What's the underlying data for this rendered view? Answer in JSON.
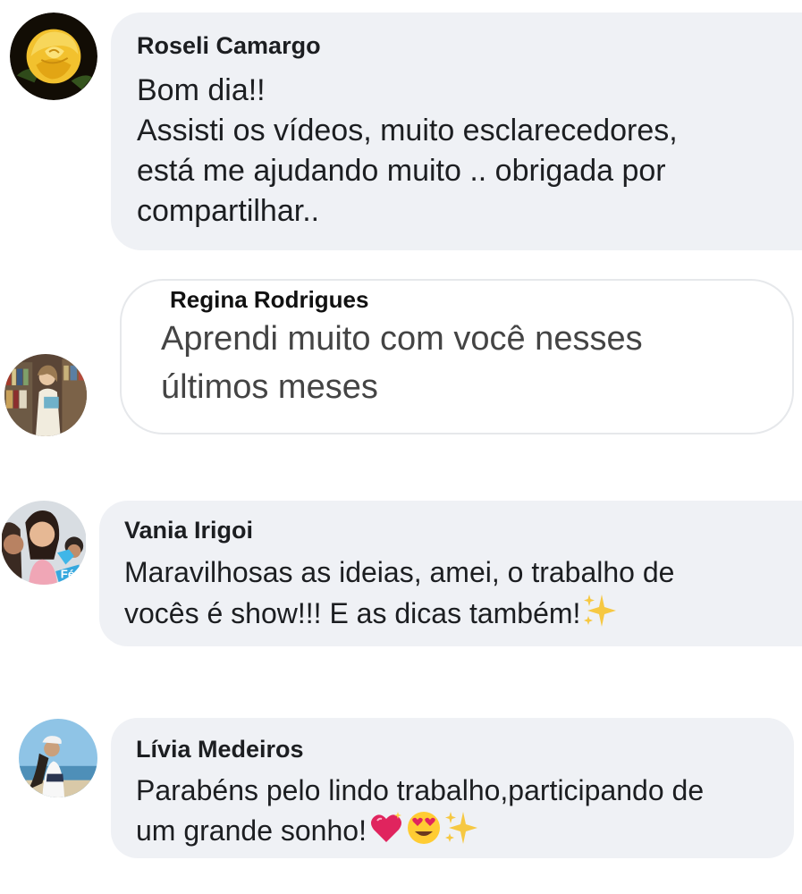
{
  "comments": [
    {
      "author": "Roseli Camargo",
      "lines": [
        "Bom dia!!",
        "Assisti os vídeos, muito esclarecedores,",
        "está me ajudando muito .. obrigada por",
        "compartilhar.."
      ],
      "avatar_icon": "yellow-rose-avatar"
    },
    {
      "author": "Regina Rodrigues",
      "lines": [
        "Aprendi muito com você nesses",
        "últimos meses"
      ],
      "avatar_icon": "woman-library-avatar"
    },
    {
      "author": "Vania Irigoi",
      "lines": [
        "Maravilhosas as ideias, amei, o trabalho de",
        "vocês é show!!! E as dicas também!"
      ],
      "emojis": [
        "sparkles"
      ],
      "avatar_icon": "family-selfie-avatar"
    },
    {
      "author": "Lívia Medeiros",
      "lines": [
        "Parabéns pelo lindo trabalho,participando de",
        "um grande sonho!"
      ],
      "emojis": [
        "sparkling-heart",
        "heart-eyes",
        "sparkles"
      ],
      "avatar_icon": "beach-woman-avatar"
    }
  ],
  "colors": {
    "bubble_background": "#eff1f5",
    "text": "#1c1e21",
    "bubble_border": "#e6e8eb"
  }
}
